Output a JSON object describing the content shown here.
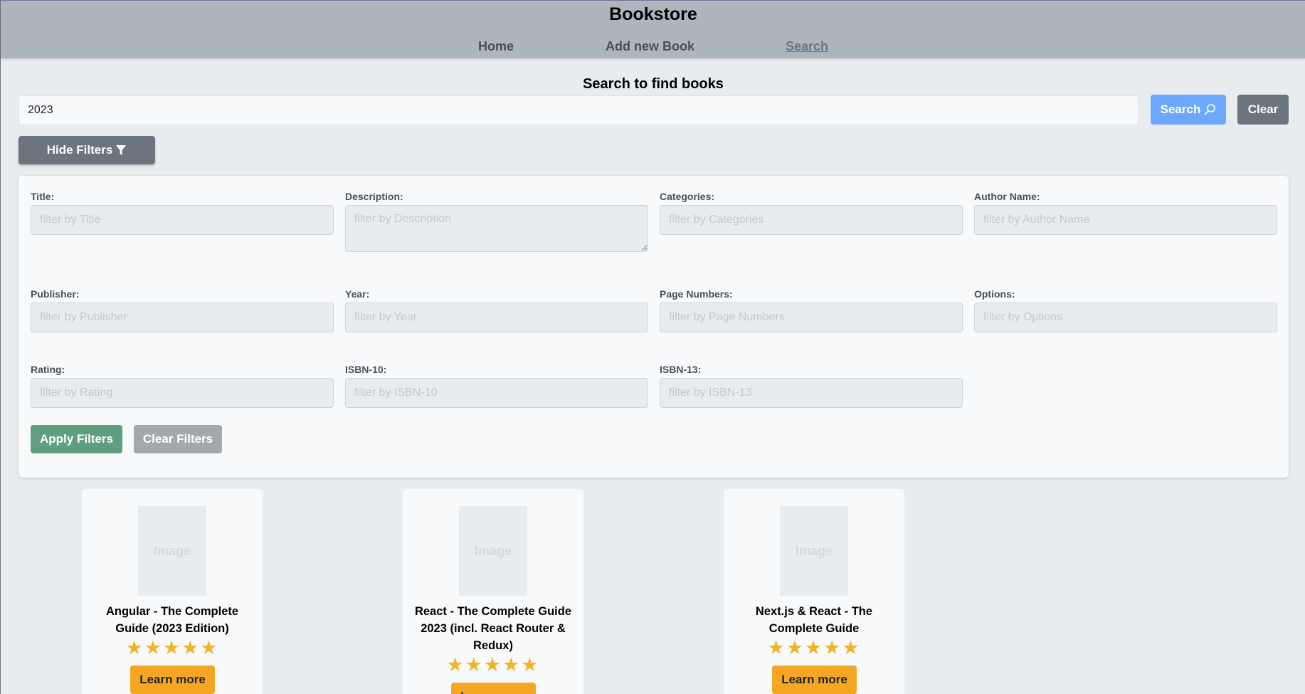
{
  "header": {
    "brand": "Bookstore",
    "nav": [
      {
        "label": "Home"
      },
      {
        "label": "Add new Book"
      },
      {
        "label": "Search"
      }
    ]
  },
  "search": {
    "heading": "Search to find books",
    "value": "2023",
    "search_label": "Search",
    "clear_label": "Clear",
    "toggle_filters_label": "Hide Filters"
  },
  "filters": {
    "fields": [
      {
        "label": "Title:",
        "placeholder": "filter by Title"
      },
      {
        "label": "Description:",
        "placeholder": "filter by Description"
      },
      {
        "label": "Categories:",
        "placeholder": "filter by Categories"
      },
      {
        "label": "Author Name:",
        "placeholder": "filter by Author Name"
      },
      {
        "label": "Publisher:",
        "placeholder": "filter by Publisher"
      },
      {
        "label": "Year:",
        "placeholder": "filter by Year"
      },
      {
        "label": "Page Numbers:",
        "placeholder": "filter by Page Numbers"
      },
      {
        "label": "Options:",
        "placeholder": "filter by Options"
      },
      {
        "label": "Rating:",
        "placeholder": "filter by Rating"
      },
      {
        "label": "ISBN-10:",
        "placeholder": "filter by ISBN-10"
      },
      {
        "label": "ISBN-13:",
        "placeholder": "filter by ISBN-13"
      }
    ],
    "apply_label": "Apply Filters",
    "clear_label": "Clear Filters"
  },
  "books": [
    {
      "image_text": "Image",
      "title": "Angular - The Complete Guide (2023 Edition)",
      "rating": 5,
      "stars": "★★★★★",
      "button": "Learn more"
    },
    {
      "image_text": "Image",
      "title": "React - The Complete Guide 2023 (incl. React Router & Redux)",
      "rating": 5,
      "stars": "★★★★★",
      "button": "Learn more"
    },
    {
      "image_text": "Image",
      "title": "Next.js & React - The Complete Guide",
      "rating": 5,
      "stars": "★★★★★",
      "button": "Learn more"
    }
  ],
  "colors": {
    "header_bg": "#adb5bd",
    "page_bg": "#e9ecef",
    "search_button": "#6ea8fe",
    "apply_button": "#5f9e7e",
    "learn_button": "#f5a623",
    "star": "#f0b429"
  }
}
